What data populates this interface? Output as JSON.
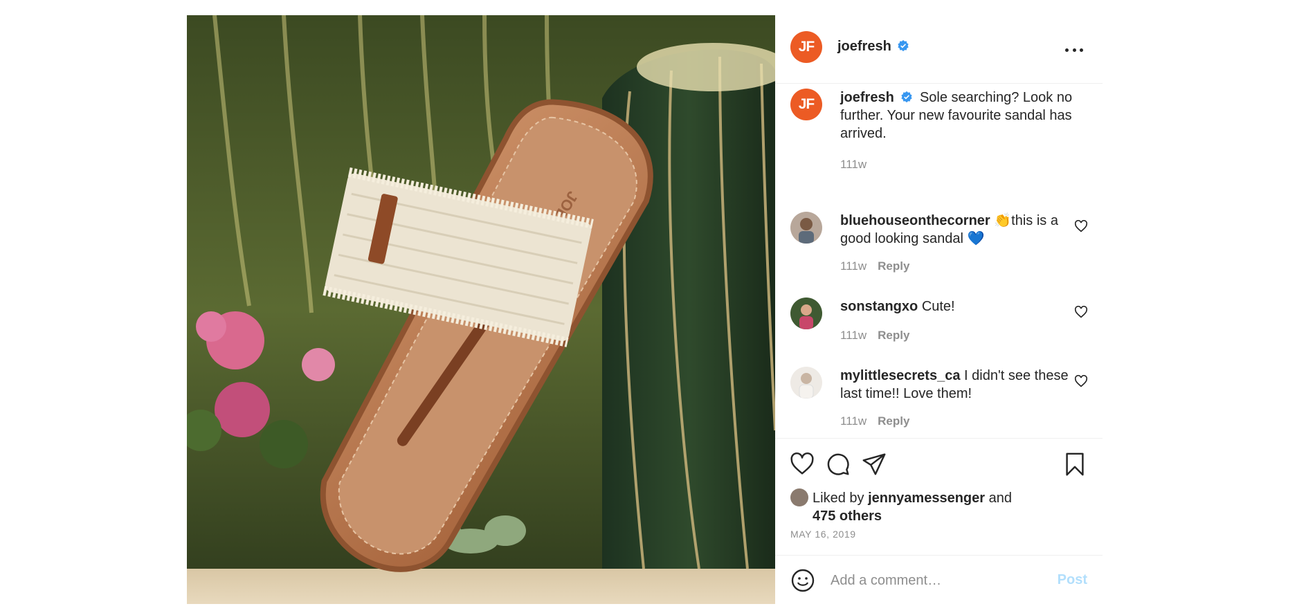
{
  "post": {
    "account": {
      "username": "joefresh",
      "avatar_initials": "JF",
      "verified": true
    },
    "caption": {
      "username": "joefresh",
      "text": "Sole searching? Look no further. Your new favourite sandal has arrived.",
      "age": "111w"
    },
    "comments": [
      {
        "username": "bluehouseonthecorner",
        "text": "👏this is a good looking sandal 💙",
        "age": "111w",
        "reply_label": "Reply"
      },
      {
        "username": "sonstangxo",
        "text": "Cute!",
        "age": "111w",
        "reply_label": "Reply"
      },
      {
        "username": "mylittlesecrets_ca",
        "text": "I didn't see these last time!! Love them!",
        "age": "111w",
        "reply_label": "Reply"
      }
    ],
    "likes": {
      "prefix": "Liked by",
      "user": "jennyamessenger",
      "conj": "and",
      "others": "475 others"
    },
    "date": "MAY 16, 2019",
    "add_comment": {
      "placeholder": "Add a comment…",
      "post_label": "Post"
    }
  },
  "image": {
    "watermark_text": "JOE FRESH"
  },
  "colors": {
    "brand": "#ec5b24",
    "verified": "#3897f0",
    "post_button": "#b2dffc",
    "meta_text": "#8e8e8e"
  },
  "icons": [
    "verified-badge-icon",
    "more-options-icon",
    "heart-icon",
    "comment-icon",
    "share-icon",
    "bookmark-icon",
    "smiley-icon"
  ]
}
